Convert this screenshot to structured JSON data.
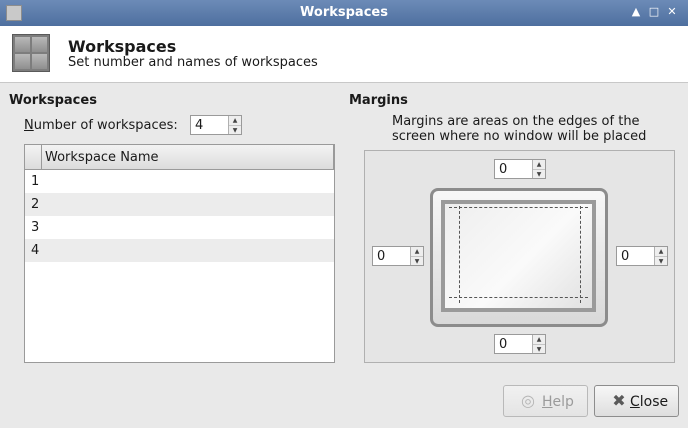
{
  "window": {
    "title": "Workspaces"
  },
  "header": {
    "title": "Workspaces",
    "subtitle": "Set number and names of workspaces"
  },
  "workspaces": {
    "section_title": "Workspaces",
    "count_label_mnemonic": "N",
    "count_label_rest": "umber of workspaces:",
    "count_value": "4",
    "column_header": "Workspace Name",
    "rows": [
      {
        "num": "1",
        "name": ""
      },
      {
        "num": "2",
        "name": ""
      },
      {
        "num": "3",
        "name": ""
      },
      {
        "num": "4",
        "name": ""
      }
    ]
  },
  "margins": {
    "section_title": "Margins",
    "description_line1": "Margins are areas on the edges of the",
    "description_line2": "screen where no window will be placed",
    "top": "0",
    "left": "0",
    "right": "0",
    "bottom": "0"
  },
  "buttons": {
    "help_mnemonic": "H",
    "help_rest": "elp",
    "close_mnemonic": "C",
    "close_rest": "lose"
  },
  "icons": {
    "window_menu": "window-menu-icon",
    "app": "workspaces-grid-icon",
    "help": "help-icon",
    "close": "close-x-icon"
  }
}
